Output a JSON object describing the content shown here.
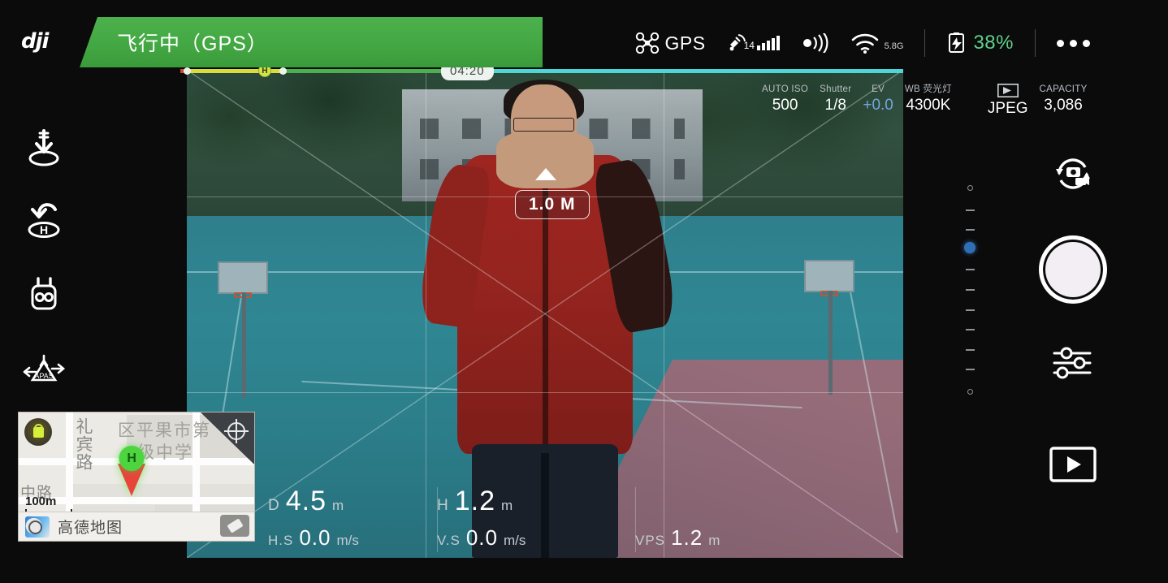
{
  "app": {
    "brand": "dji",
    "status_banner": "飞行中（GPS）",
    "banner_color": "#43a843"
  },
  "status_bar": {
    "gps": {
      "icon": "drone-icon",
      "label": "GPS"
    },
    "satellite": {
      "icon": "satellite-icon",
      "count": "14",
      "bars": 5
    },
    "transmission": {
      "icon": "signal-wave-icon"
    },
    "wifi": {
      "icon": "wifi-icon",
      "band": "5.8G"
    },
    "battery": {
      "icon": "battery-icon",
      "percent": "38%",
      "color": "#5fd08a"
    },
    "more": {
      "icon": "more-dots-icon"
    }
  },
  "camera_settings": {
    "iso": {
      "label": "AUTO ISO",
      "value": "500"
    },
    "shutter": {
      "label": "Shutter",
      "value": "1/8"
    },
    "ev": {
      "label": "EV",
      "value": "+0.0",
      "color": "#6fa8dc"
    },
    "wb": {
      "label": "WB 荧光灯",
      "value": "4300K"
    },
    "format": {
      "icon": "sd-card-icon",
      "value": "JPEG"
    },
    "capacity": {
      "label": "CAPACITY",
      "value": "3,086"
    }
  },
  "left_rail": [
    {
      "name": "auto-landing-button",
      "icon": "land-arrow-icon",
      "label": "Auto Landing"
    },
    {
      "name": "return-to-home-button",
      "icon": "return-home-icon",
      "label": "Return to Home"
    },
    {
      "name": "remote-controller-button",
      "icon": "remote-controller-icon",
      "label": "Remote Controller"
    },
    {
      "name": "apas-button",
      "icon": "apas-icon",
      "label": "APAS"
    }
  ],
  "right_rail": {
    "mode_toggle": {
      "icon": "photo-video-switch-icon",
      "label": "Photo/Video Mode"
    },
    "shutter": {
      "icon": "shutter-button-icon",
      "label": "Shutter"
    },
    "camera_settings": {
      "icon": "sliders-icon",
      "label": "Camera Settings"
    },
    "playback": {
      "icon": "playback-icon",
      "label": "Playback"
    }
  },
  "flight_hud": {
    "timer": "04:20",
    "altitude_badge": "1.0 M",
    "home_marker": "H"
  },
  "telemetry": {
    "distance": {
      "key": "D",
      "value": "4.5",
      "unit": "m"
    },
    "height": {
      "key": "H",
      "value": "1.2",
      "unit": "m"
    },
    "horizontal_speed": {
      "key": "H.S",
      "value": "0.0",
      "unit": "m/s"
    },
    "vertical_speed": {
      "key": "V.S",
      "value": "0.0",
      "unit": "m/s"
    },
    "vps": {
      "key": "VPS",
      "value": "1.2",
      "unit": "m"
    }
  },
  "map": {
    "lock_icon": "map-lock-icon",
    "compass_icon": "compass-recenter-icon",
    "street_label": "礼宾路",
    "street_label_2": "中路",
    "poi_line1": "区平果市第",
    "poi_line2": "级中学",
    "scale": "100m",
    "provider": "高德地图",
    "marker": "H",
    "eraser_icon": "eraser-icon"
  }
}
